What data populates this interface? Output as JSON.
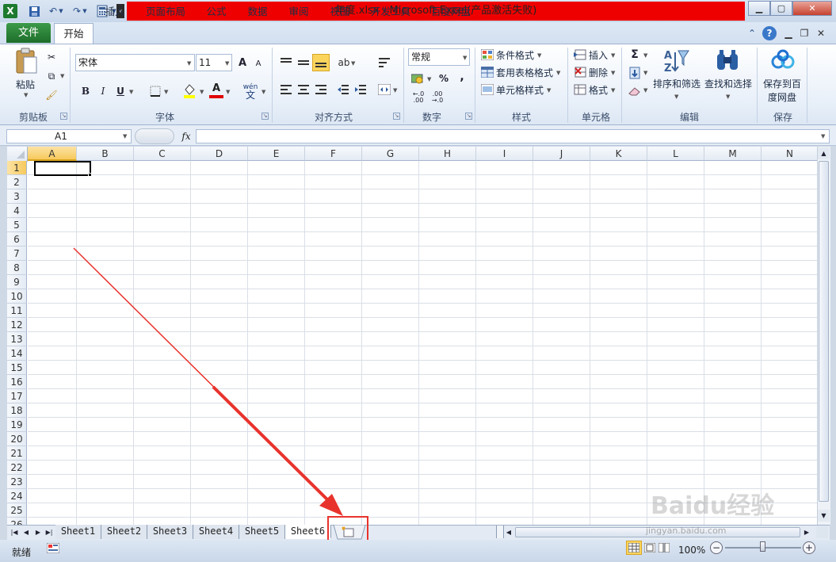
{
  "window": {
    "title": "年度.xlsx - Microsoft Excel(产品激活失败)"
  },
  "tabs": {
    "file": "文件",
    "home": "开始",
    "items": [
      "插入",
      "页面布局",
      "公式",
      "数据",
      "审阅",
      "视图",
      "开发工具",
      "百度网盘"
    ]
  },
  "ribbon": {
    "clipboard": {
      "paste": "粘贴",
      "label": "剪贴板"
    },
    "font": {
      "name": "宋体",
      "size": "11",
      "label": "字体",
      "bold": "B",
      "italic": "I",
      "underline": "U",
      "grow": "A",
      "shrink": "A",
      "fontcolor": "A",
      "phonetic": "wén"
    },
    "align": {
      "label": "对齐方式"
    },
    "number": {
      "format": "常规",
      "label": "数字",
      "percent": "%",
      "comma": ","
    },
    "styles": {
      "cond": "条件格式",
      "table": "套用表格格式",
      "cell": "单元格样式",
      "label": "样式"
    },
    "cells": {
      "insert": "插入",
      "delete": "删除",
      "format": "格式",
      "label": "单元格"
    },
    "editing": {
      "sigma": "Σ",
      "sort": "排序和筛选",
      "find": "查找和选择",
      "label": "编辑"
    },
    "save": {
      "line1": "保存到百",
      "line2": "度网盘",
      "label": "保存"
    }
  },
  "formula": {
    "namebox": "A1",
    "fx": "fx",
    "value": ""
  },
  "columns": [
    "A",
    "B",
    "C",
    "D",
    "E",
    "F",
    "G",
    "H",
    "I",
    "J",
    "K",
    "L",
    "M",
    "N"
  ],
  "rows": [
    "1",
    "2",
    "3",
    "4",
    "5",
    "6",
    "7",
    "8",
    "9",
    "10",
    "11",
    "12",
    "13",
    "14",
    "15",
    "16",
    "17",
    "18",
    "19",
    "20",
    "21",
    "22",
    "23",
    "24",
    "25",
    "26"
  ],
  "sheets": [
    "Sheet1",
    "Sheet2",
    "Sheet3",
    "Sheet4",
    "Sheet5",
    "Sheet6"
  ],
  "status": {
    "ready": "就绪",
    "zoom": "100%"
  },
  "watermark": {
    "brand": "Baidu经验",
    "url": "jingyan.baidu.com"
  },
  "colors": {
    "titleHighlight": "#ef0000",
    "fileTab": "#1d6e2a",
    "annotation": "#e8332d"
  }
}
